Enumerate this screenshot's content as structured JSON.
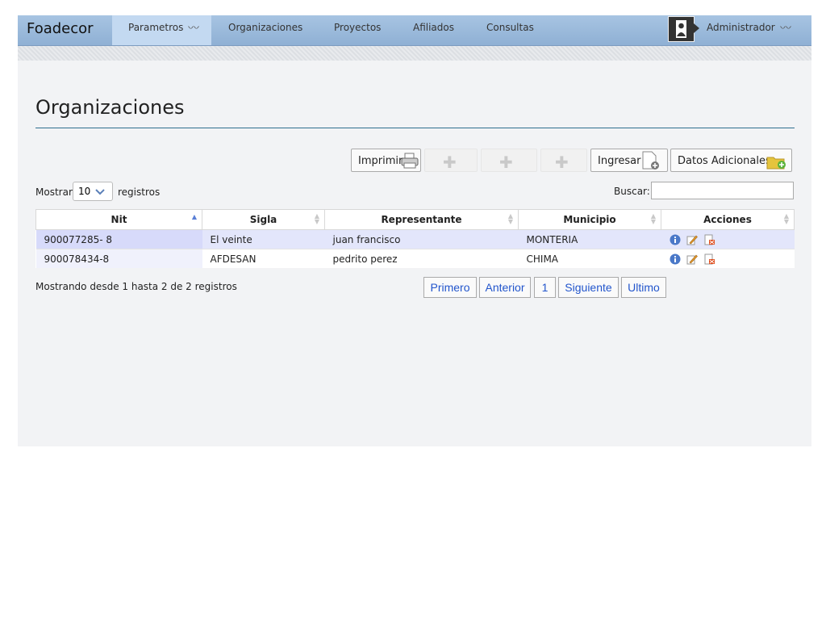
{
  "app": {
    "brand": "Foadecor"
  },
  "nav": {
    "items": [
      {
        "label": "Parametros"
      },
      {
        "label": "Organizaciones"
      },
      {
        "label": "Proyectos"
      },
      {
        "label": "Afiliados"
      },
      {
        "label": "Consultas"
      }
    ],
    "user_label": "Administrador",
    "dropdown_glyph": "〰"
  },
  "page": {
    "title": "Organizaciones"
  },
  "toolbar": {
    "print_label": "Imprimir",
    "add_label": "Ingresar",
    "extra_label": "Datos Adicionales",
    "placeholder_icon": "puzzle-icon"
  },
  "table_controls": {
    "show_label": "Mostrar",
    "page_size": "10",
    "records_label": "registros",
    "search_label": "Buscar:",
    "search_value": ""
  },
  "table": {
    "columns": [
      "Nit",
      "Sigla",
      "Representante",
      "Municipio",
      "Acciones"
    ],
    "rows": [
      {
        "nit": "900077285- 8",
        "sigla": "El veinte",
        "representante": "juan francisco",
        "municipio": "MONTERIA"
      },
      {
        "nit": "900078434-8",
        "sigla": "AFDESAN",
        "representante": "pedrito perez",
        "municipio": "CHIMA"
      }
    ]
  },
  "footer": {
    "info": "Mostrando desde 1 hasta 2 de 2 registros",
    "first": "Primero",
    "prev": "Anterior",
    "page": "1",
    "next": "Siguiente",
    "last": "Ultimo"
  }
}
